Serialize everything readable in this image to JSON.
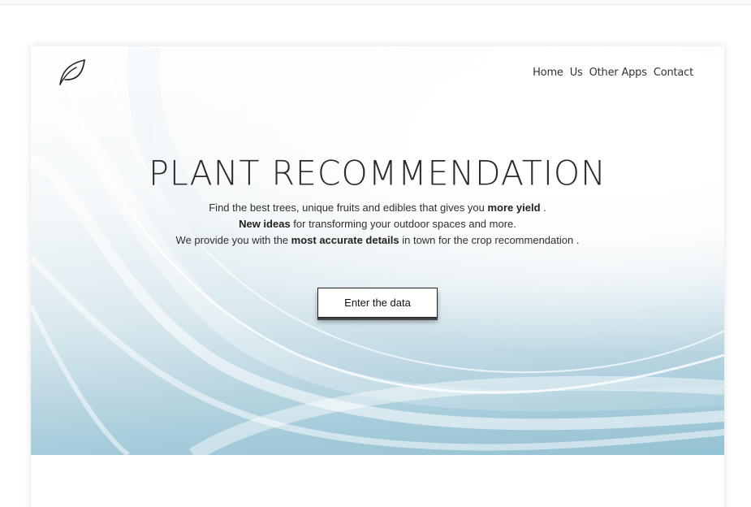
{
  "nav": {
    "items": [
      {
        "label": "Home"
      },
      {
        "label": "Us"
      },
      {
        "label": "Other Apps"
      },
      {
        "label": "Contact"
      }
    ]
  },
  "hero": {
    "title": "PLANT RECOMMENDATION",
    "line1_pre": "Find the best trees, unique fruits and edibles that gives you ",
    "line1_bold": "more yield",
    "line1_post": " .",
    "line2_bold": "New ideas",
    "line2_post": " for transforming your outdoor spaces and more.",
    "line3_pre": "We provide you with the ",
    "line3_bold": "most accurate details",
    "line3_post": " in town for the crop recommendation .",
    "cta_label": "Enter the data"
  },
  "logo": {
    "icon": "leaf-icon"
  },
  "colors": {
    "hero_light": "#ffffff",
    "hero_blue": "#94c1d3",
    "text": "#2a2a2a"
  }
}
